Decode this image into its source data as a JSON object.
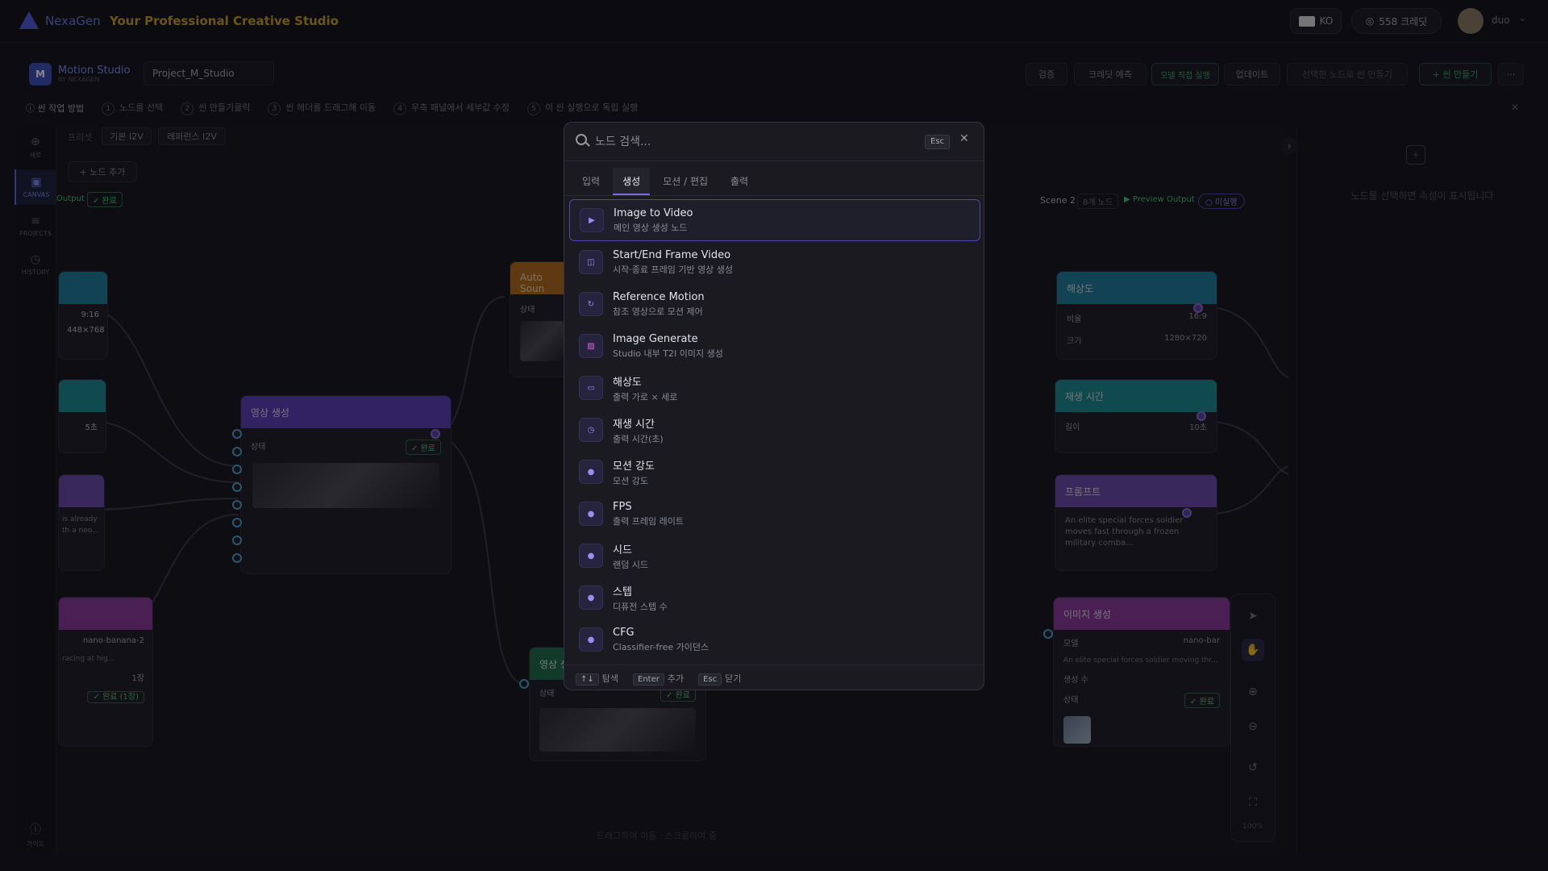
{
  "topbar": {
    "app_name": "NexaGen",
    "tagline": "Your Professional Creative Studio",
    "lang": "KO",
    "credits": "558 크레딧",
    "user": "duo"
  },
  "studio": {
    "title": "Motion Studio",
    "subtitle": "BY NEXAGEN",
    "project_name": "Project_M_Studio",
    "buttons": {
      "check": "검증",
      "credit_estimate": "크레딧 예측",
      "run_model": "모델 직접 실행",
      "update": "업데이트",
      "make_selected": "선택한 노드로 씬 만들기",
      "new_scene": "+ 씬 만들기",
      "more": "···"
    }
  },
  "guide": {
    "title": "씬 작업 방법",
    "steps": [
      {
        "n": "1",
        "label": "노드를 선택"
      },
      {
        "n": "2",
        "label": "씬 만들기클릭"
      },
      {
        "n": "3",
        "label": "씬 헤더를 드래그해 이동"
      },
      {
        "n": "4",
        "label": "우측 패널에서 세부값 수정"
      },
      {
        "n": "5",
        "label": "이 씬 실행으로 독립 실행"
      }
    ]
  },
  "rail": {
    "new": "새로",
    "canvas": "CANVAS",
    "projects": "PROJECTS",
    "history": "HISTORY",
    "guide": "가이드"
  },
  "canvas": {
    "preset_label": "프리셋",
    "preset_1": "기본 I2V",
    "preset_2": "레퍼런스 I2V",
    "add_node": "+ 노드 추가",
    "output_label": "Output",
    "done": "✓ 완료",
    "node_left_1": {
      "ratio": "9:16",
      "size": "448×768"
    },
    "node_left_2": {
      "duration": "5초"
    },
    "node_left_3": {
      "text1": "is already",
      "text2": "th a neo..."
    },
    "node_left_4": {
      "model": "nano-banana-2",
      "text": "racing at hig...",
      "count": "1장",
      "status": "✓ 완료 (1장)"
    },
    "video_node": {
      "title": "영상 생성",
      "status_label": "상태",
      "status": "✓ 완료"
    },
    "auto_sound": {
      "title": "Auto Soun",
      "status_label": "상태"
    },
    "video_node_2": {
      "title": "영상 생",
      "status_label": "상태",
      "status": "✓ 완료"
    },
    "scene2": {
      "label": "Scene 2",
      "count": "8개 노드",
      "preview": "▶ Preview Output",
      "pending": "○ 미실행"
    },
    "res_node": {
      "title": "해상도",
      "ratio_label": "비율",
      "ratio": "16:9",
      "size_label": "크기",
      "size": "1280×720"
    },
    "dur_node": {
      "title": "재생 시간",
      "len_label": "길이",
      "len": "10초"
    },
    "prompt_node": {
      "title": "프롬프트",
      "text": "An elite special forces soldier moves fast through a frozen military comba..."
    },
    "img_node": {
      "title": "이미지 생성",
      "model_label": "모델",
      "model": "nano-bar",
      "desc": "An elite special forces soldier moving thr...",
      "count_label": "생성 수",
      "status_label": "상태",
      "status": "✓ 완료"
    },
    "hint": "드래그하여 이동 · 스크롤하여 줌",
    "zoom": "100%"
  },
  "right_panel": {
    "empty_text": "노드를 선택하면 속성이 표시됩니다"
  },
  "modal": {
    "search_placeholder": "노드 검색...",
    "esc": "Esc",
    "tabs": [
      "입력",
      "생성",
      "모션 / 편집",
      "출력"
    ],
    "active_tab": 1,
    "items": [
      {
        "title": "Image to Video",
        "sub": "메인 영상 생성 노드",
        "icon": "play-icon"
      },
      {
        "title": "Start/End Frame Video",
        "sub": "시작·종료 프레임 기반 영상 생성",
        "icon": "frames-icon"
      },
      {
        "title": "Reference Motion",
        "sub": "참조 영상으로 모션 제어",
        "icon": "motion-icon"
      },
      {
        "title": "Image Generate",
        "sub": "Studio 내부 T2I 이미지 생성",
        "icon": "image-icon"
      },
      {
        "title": "해상도",
        "sub": "출력 가로 × 세로",
        "icon": "resolution-icon"
      },
      {
        "title": "재생 시간",
        "sub": "출력 시간(초)",
        "icon": "clock-icon"
      },
      {
        "title": "모션 강도",
        "sub": "모션 강도",
        "icon": "dot-icon"
      },
      {
        "title": "FPS",
        "sub": "출력 프레임 레이트",
        "icon": "dot-icon"
      },
      {
        "title": "시드",
        "sub": "랜덤 시드",
        "icon": "dot-icon"
      },
      {
        "title": "스텝",
        "sub": "디퓨전 스텝 수",
        "icon": "dot-icon"
      },
      {
        "title": "CFG",
        "sub": "Classifier-free 가이던스",
        "icon": "dot-icon"
      }
    ],
    "footer": {
      "nav_key": "↑↓",
      "nav": "탐색",
      "enter_key": "Enter",
      "enter": "추가",
      "esc_key": "Esc",
      "esc": "닫기"
    }
  }
}
